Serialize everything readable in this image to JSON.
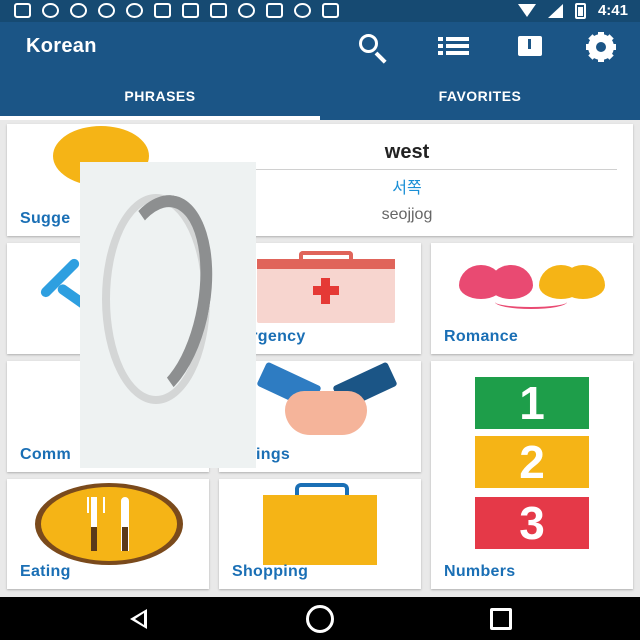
{
  "status_bar": {
    "time": "4:41"
  },
  "app_bar": {
    "title": "Korean"
  },
  "tabs": [
    {
      "label": "PHRASES",
      "active": true
    },
    {
      "label": "FAVORITES",
      "active": false
    }
  ],
  "suggestion": {
    "label": "Sugge",
    "english": "west",
    "korean": "서쪽",
    "romanization": "seojjog"
  },
  "categories": [
    {
      "label": "Comm",
      "icon": "communication-icon"
    },
    {
      "label": "nergency",
      "icon": "first-aid-kit-icon"
    },
    {
      "label": "Romance",
      "icon": "hearts-balloon-icon"
    },
    {
      "label": "eetings",
      "icon": "handshake-icon"
    },
    {
      "label": "Numbers",
      "icon": "numbers-blocks-icon",
      "digits": [
        "1",
        "2",
        "3"
      ]
    },
    {
      "label": "Eating",
      "icon": "plate-fork-knife-icon"
    },
    {
      "label": "Shopping",
      "icon": "shopping-bag-icon"
    }
  ],
  "colors": {
    "app_bar": "#1b5586",
    "status_bar": "#164a72",
    "label": "#1a6fb5",
    "korean_text": "#1a8fd6",
    "accent_yellow": "#f5b416"
  }
}
